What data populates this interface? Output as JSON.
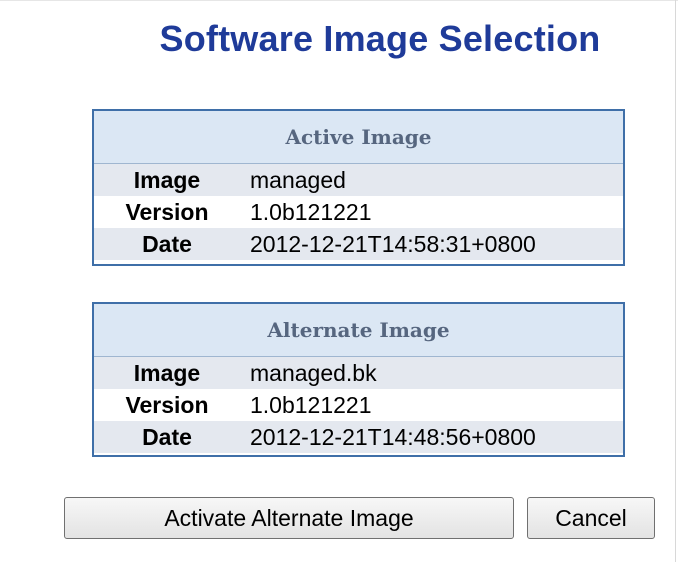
{
  "page": {
    "title": "Software Image Selection"
  },
  "active_image": {
    "header": "Active Image",
    "rows": [
      {
        "label": "Image",
        "value": "managed"
      },
      {
        "label": "Version",
        "value": "1.0b121221"
      },
      {
        "label": "Date",
        "value": "2012-12-21T14:58:31+0800"
      }
    ]
  },
  "alternate_image": {
    "header": "Alternate Image",
    "rows": [
      {
        "label": "Image",
        "value": "managed.bk"
      },
      {
        "label": "Version",
        "value": "1.0b121221"
      },
      {
        "label": "Date",
        "value": "2012-12-21T14:48:56+0800"
      }
    ]
  },
  "actions": {
    "activate_label": "Activate Alternate Image",
    "cancel_label": "Cancel"
  },
  "colors": {
    "title": "#1f3b99",
    "panel_border": "#3f6fa8",
    "panel_header_bg": "#dbe7f4",
    "row_shade": "#e4e8ef"
  }
}
